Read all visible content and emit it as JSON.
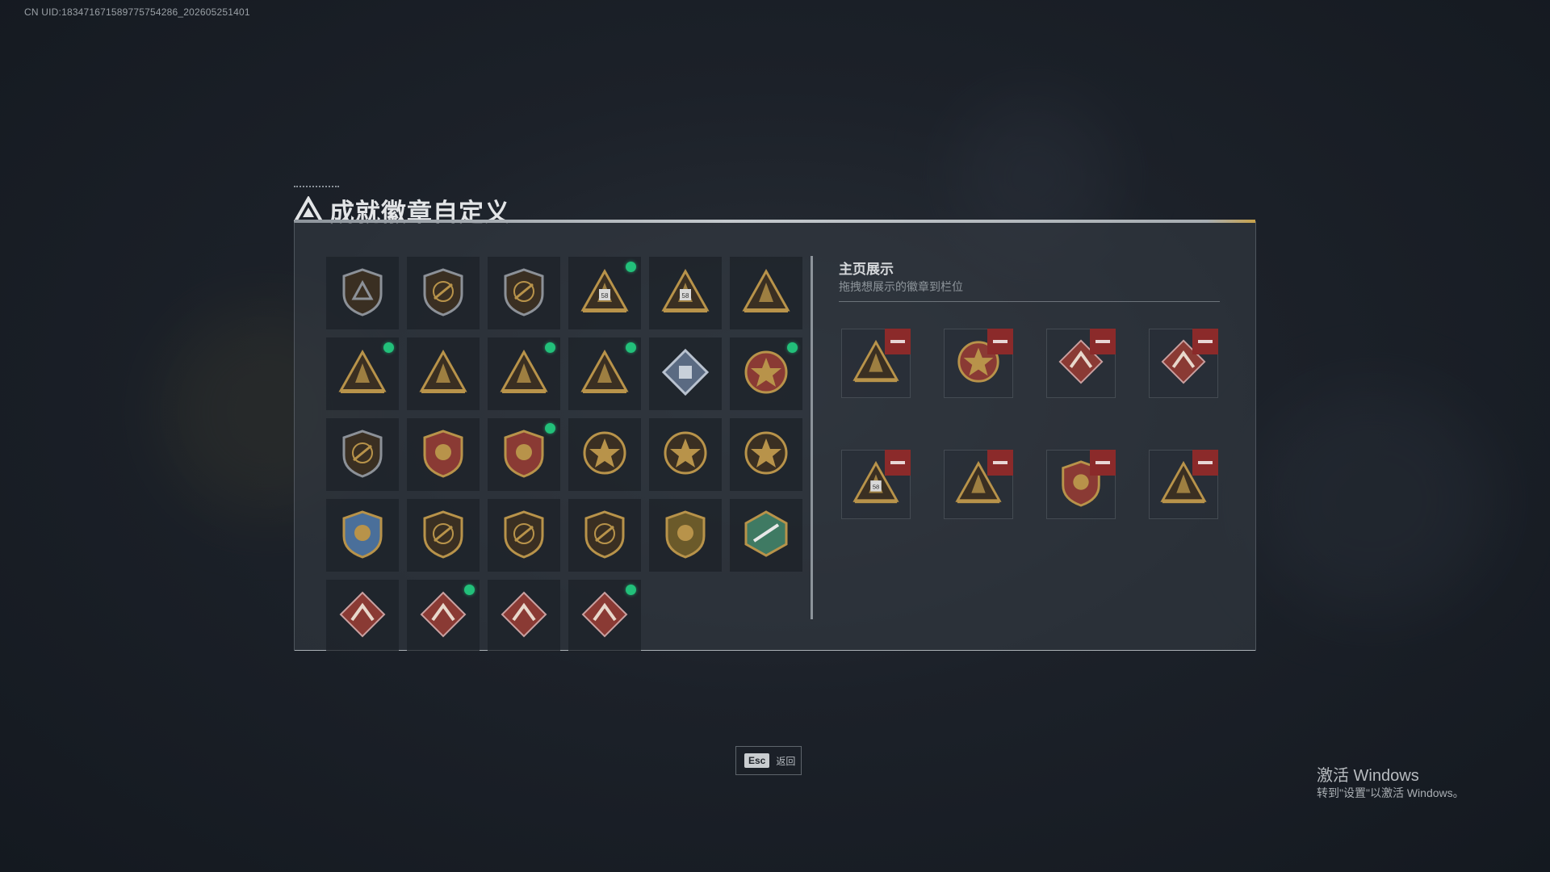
{
  "uid_text": "CN UID:1834716715897757542​86_202605251401",
  "title": "成就徽章自定义",
  "badge_grid": {
    "rows": [
      [
        {
          "icon": "triangle-shield-icon",
          "new": false
        },
        {
          "icon": "helicopter-shield-icon",
          "new": false
        },
        {
          "icon": "dagger-shield-icon",
          "new": false
        },
        {
          "icon": "triangle-58-icon",
          "new": true
        },
        {
          "icon": "triangle-tank-58-icon",
          "new": false
        },
        {
          "icon": "triangle-hand-icon",
          "new": false
        }
      ],
      [
        {
          "icon": "triangle-bag-icon",
          "new": true
        },
        {
          "icon": "triangle-soldier-icon",
          "new": false
        },
        {
          "icon": "triangle-rocket-icon",
          "new": true
        },
        {
          "icon": "triangle-fish-icon",
          "new": true
        },
        {
          "icon": "diamond-cube-icon",
          "new": false
        },
        {
          "icon": "star-medal-icon",
          "new": true
        }
      ],
      [
        {
          "icon": "shield-plane-icon",
          "new": false
        },
        {
          "icon": "crest-wings-icon",
          "new": false
        },
        {
          "icon": "crest-flame-icon",
          "new": true
        },
        {
          "icon": "round-skull-icon",
          "new": false
        },
        {
          "icon": "round-demon-icon",
          "new": false
        },
        {
          "icon": "round-sunburst-icon",
          "new": false
        }
      ],
      [
        {
          "icon": "blue-crest-rifle-icon",
          "new": false
        },
        {
          "icon": "shield-rifle-icon",
          "new": false
        },
        {
          "icon": "shield-rifle-icon",
          "new": false
        },
        {
          "icon": "shield-rifle-icon",
          "new": false
        },
        {
          "icon": "gold-crest-rifle-icon",
          "new": false
        },
        {
          "icon": "green-hex-dragonfly-icon",
          "new": false
        }
      ],
      [
        {
          "icon": "red-diamond-dragon-icon",
          "new": false
        },
        {
          "icon": "red-diamond-dragon-icon",
          "new": true
        },
        {
          "icon": "red-diamond-runner-icon",
          "new": false
        },
        {
          "icon": "red-diamond-plane-icon",
          "new": true
        }
      ]
    ]
  },
  "showcase": {
    "title": "主页展示",
    "subtitle": "拖拽想展示的徽章到栏位",
    "slots": [
      {
        "icon": "triangle-rocket-icon"
      },
      {
        "icon": "star-medal-icon"
      },
      {
        "icon": "red-diamond-dragon-icon"
      },
      {
        "icon": "red-diamond-plane-icon"
      },
      {
        "icon": "triangle-58-icon"
      },
      {
        "icon": "triangle-bag-icon"
      },
      {
        "icon": "crest-flame-icon"
      },
      {
        "icon": "triangle-fish-icon"
      }
    ]
  },
  "esc_button": {
    "key": "Esc",
    "label": "返回"
  },
  "windows_watermark": {
    "line1": "激活 Windows",
    "line2": "转到\"设置\"以激活 Windows。"
  },
  "colors": {
    "new_dot": "#22c07a",
    "remove_button": "#8b2a2a",
    "gold": "#c8a24a"
  }
}
